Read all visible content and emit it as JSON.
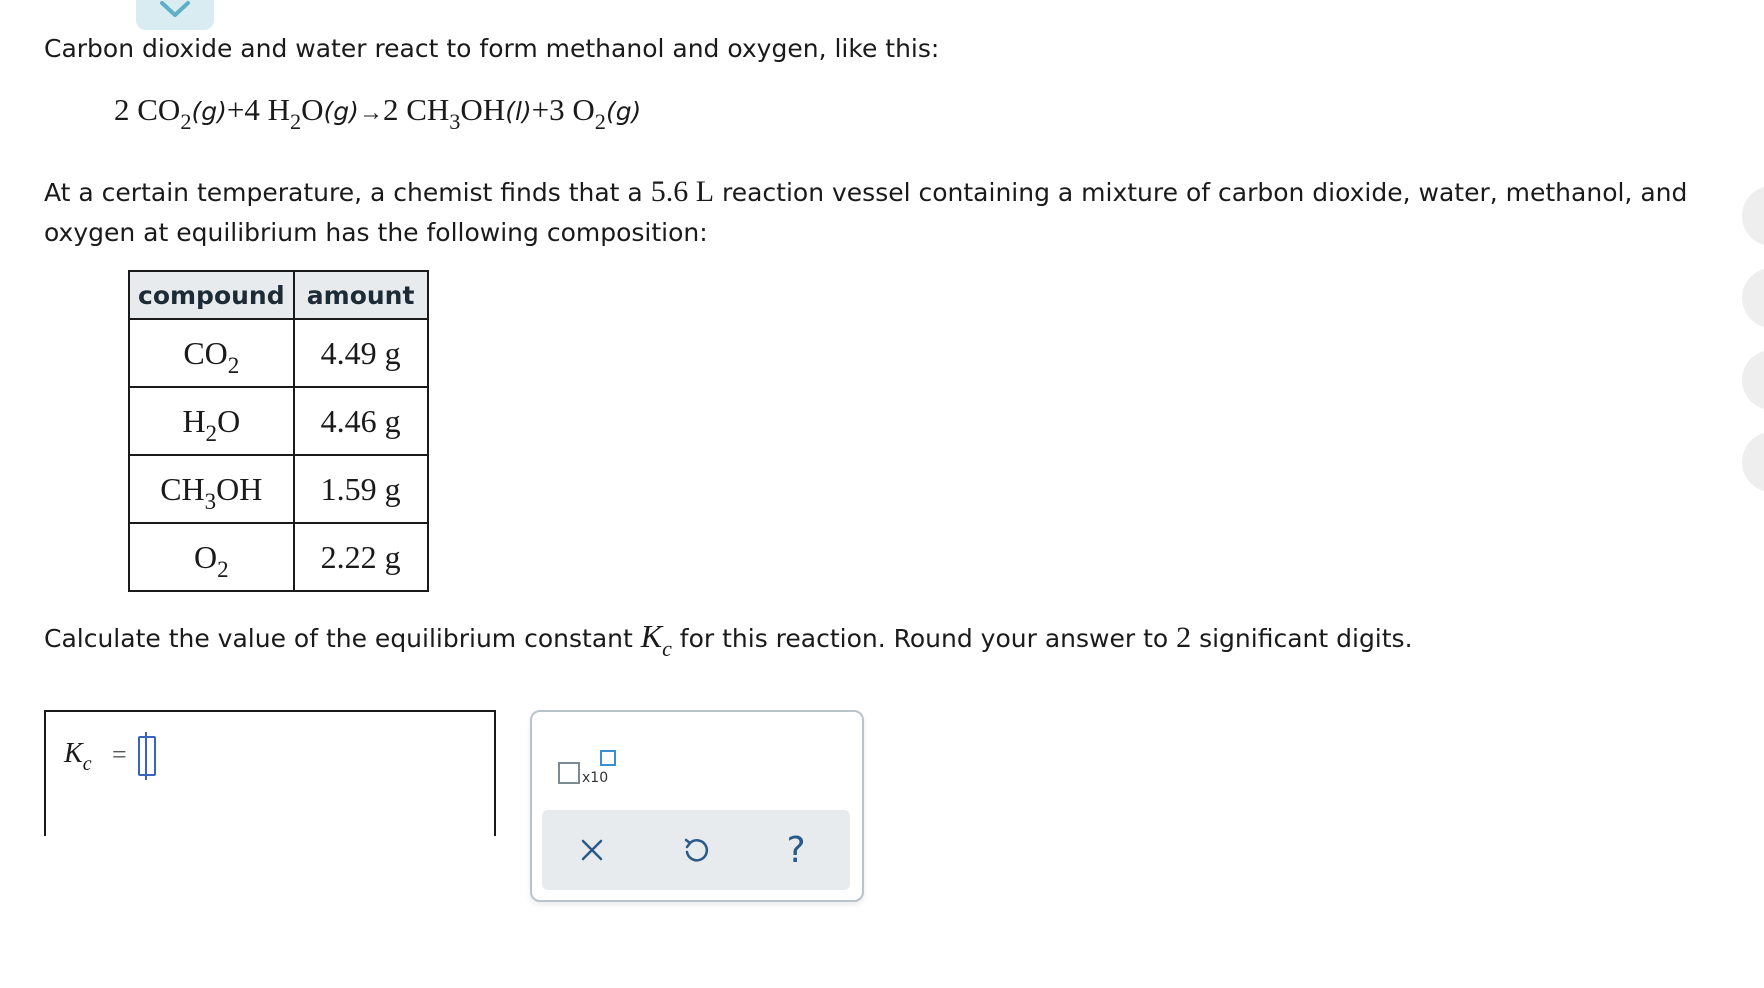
{
  "intro_text": "Carbon dioxide and water react to form methanol and oxygen, like this:",
  "equation": {
    "coef1": "2",
    "s1": "CO",
    "s1_sub": "2",
    "s1_state": "(g)",
    "plus1": "+",
    "coef2": "4",
    "s2a": "H",
    "s2_sub": "2",
    "s2b": "O",
    "s2_state": "(g)",
    "arrow": "→",
    "coef3": "2",
    "s3a": "CH",
    "s3_sub": "3",
    "s3b": "OH",
    "s3_state": "(l)",
    "plus2": "+",
    "coef4": "3",
    "s4": "O",
    "s4_sub": "2",
    "s4_state": "(g)"
  },
  "paragraph": {
    "before": "At a certain temperature, a chemist finds that a ",
    "volume": "5.6 L",
    "after": " reaction vessel containing a mixture of carbon dioxide, water, methanol, and oxygen at equilibrium has the following composition:"
  },
  "table": {
    "headers": [
      "compound",
      "amount"
    ],
    "rows": [
      {
        "compound": "CO",
        "sub": "2",
        "suffix": "",
        "amount": "4.49 g"
      },
      {
        "compound": "H",
        "sub": "2",
        "suffix": "O",
        "amount": "4.46 g"
      },
      {
        "compound": "CH",
        "sub": "3",
        "suffix": "OH",
        "amount": "1.59 g"
      },
      {
        "compound": "O",
        "sub": "2",
        "suffix": "",
        "amount": "2.22 g"
      }
    ]
  },
  "question": {
    "before": "Calculate the value of the equilibrium constant ",
    "k": "K",
    "k_sub": "c",
    "middle": " for this reaction. Round your answer to ",
    "digits": "2",
    "after": " significant digits."
  },
  "answer": {
    "label": "K",
    "label_sub": "c",
    "equals": "=",
    "value": ""
  },
  "tools": {
    "sci_label": "x10",
    "icons": [
      "scientific-notation-icon",
      "clear-x-icon",
      "undo-icon",
      "help-question-icon"
    ],
    "help_glyph": "?"
  },
  "colors": {
    "accent_tab": "#d8ecf1",
    "table_header_bg": "#e7ebed",
    "cursor_blue": "#3b63c4",
    "icon_blue": "#2a5a8a"
  }
}
